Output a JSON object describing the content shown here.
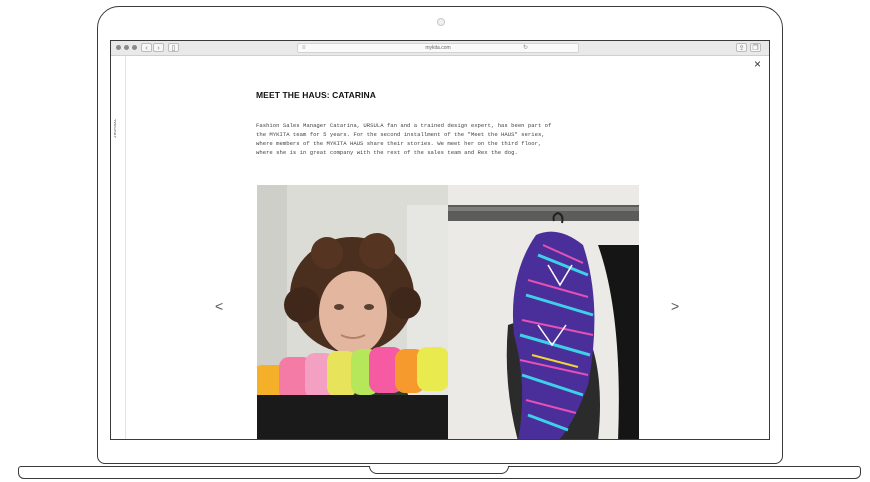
{
  "browser": {
    "url": "mykita.com"
  },
  "page": {
    "side_label": "JOURNAL",
    "title": "MEET THE HAUS: CATARINA",
    "body_lines": [
      "Fashion Sales Manager Catarina, URSULA fan and a trained design expert, has been part of",
      "the MYKITA team for 5 years. For the second installment of the \"Meet the HAUS\" series,",
      "where members of the MYKITA HAUS share their stories. We meet her on the third floor,",
      "where she is in great company with the rest of the sales team and Rex the dog."
    ],
    "close_glyph": "×",
    "prev_glyph": "<",
    "next_glyph": ">"
  },
  "icons": [
    "window-controls-icon",
    "back-icon",
    "forward-icon",
    "sidebar-icon",
    "lock-icon",
    "reload-icon",
    "share-icon",
    "tabs-icon",
    "close-icon",
    "chevron-left-icon",
    "chevron-right-icon"
  ],
  "colors": {
    "frame": "#3a3a3a",
    "toolbar": "#e9e9e9",
    "text": "#111111"
  }
}
